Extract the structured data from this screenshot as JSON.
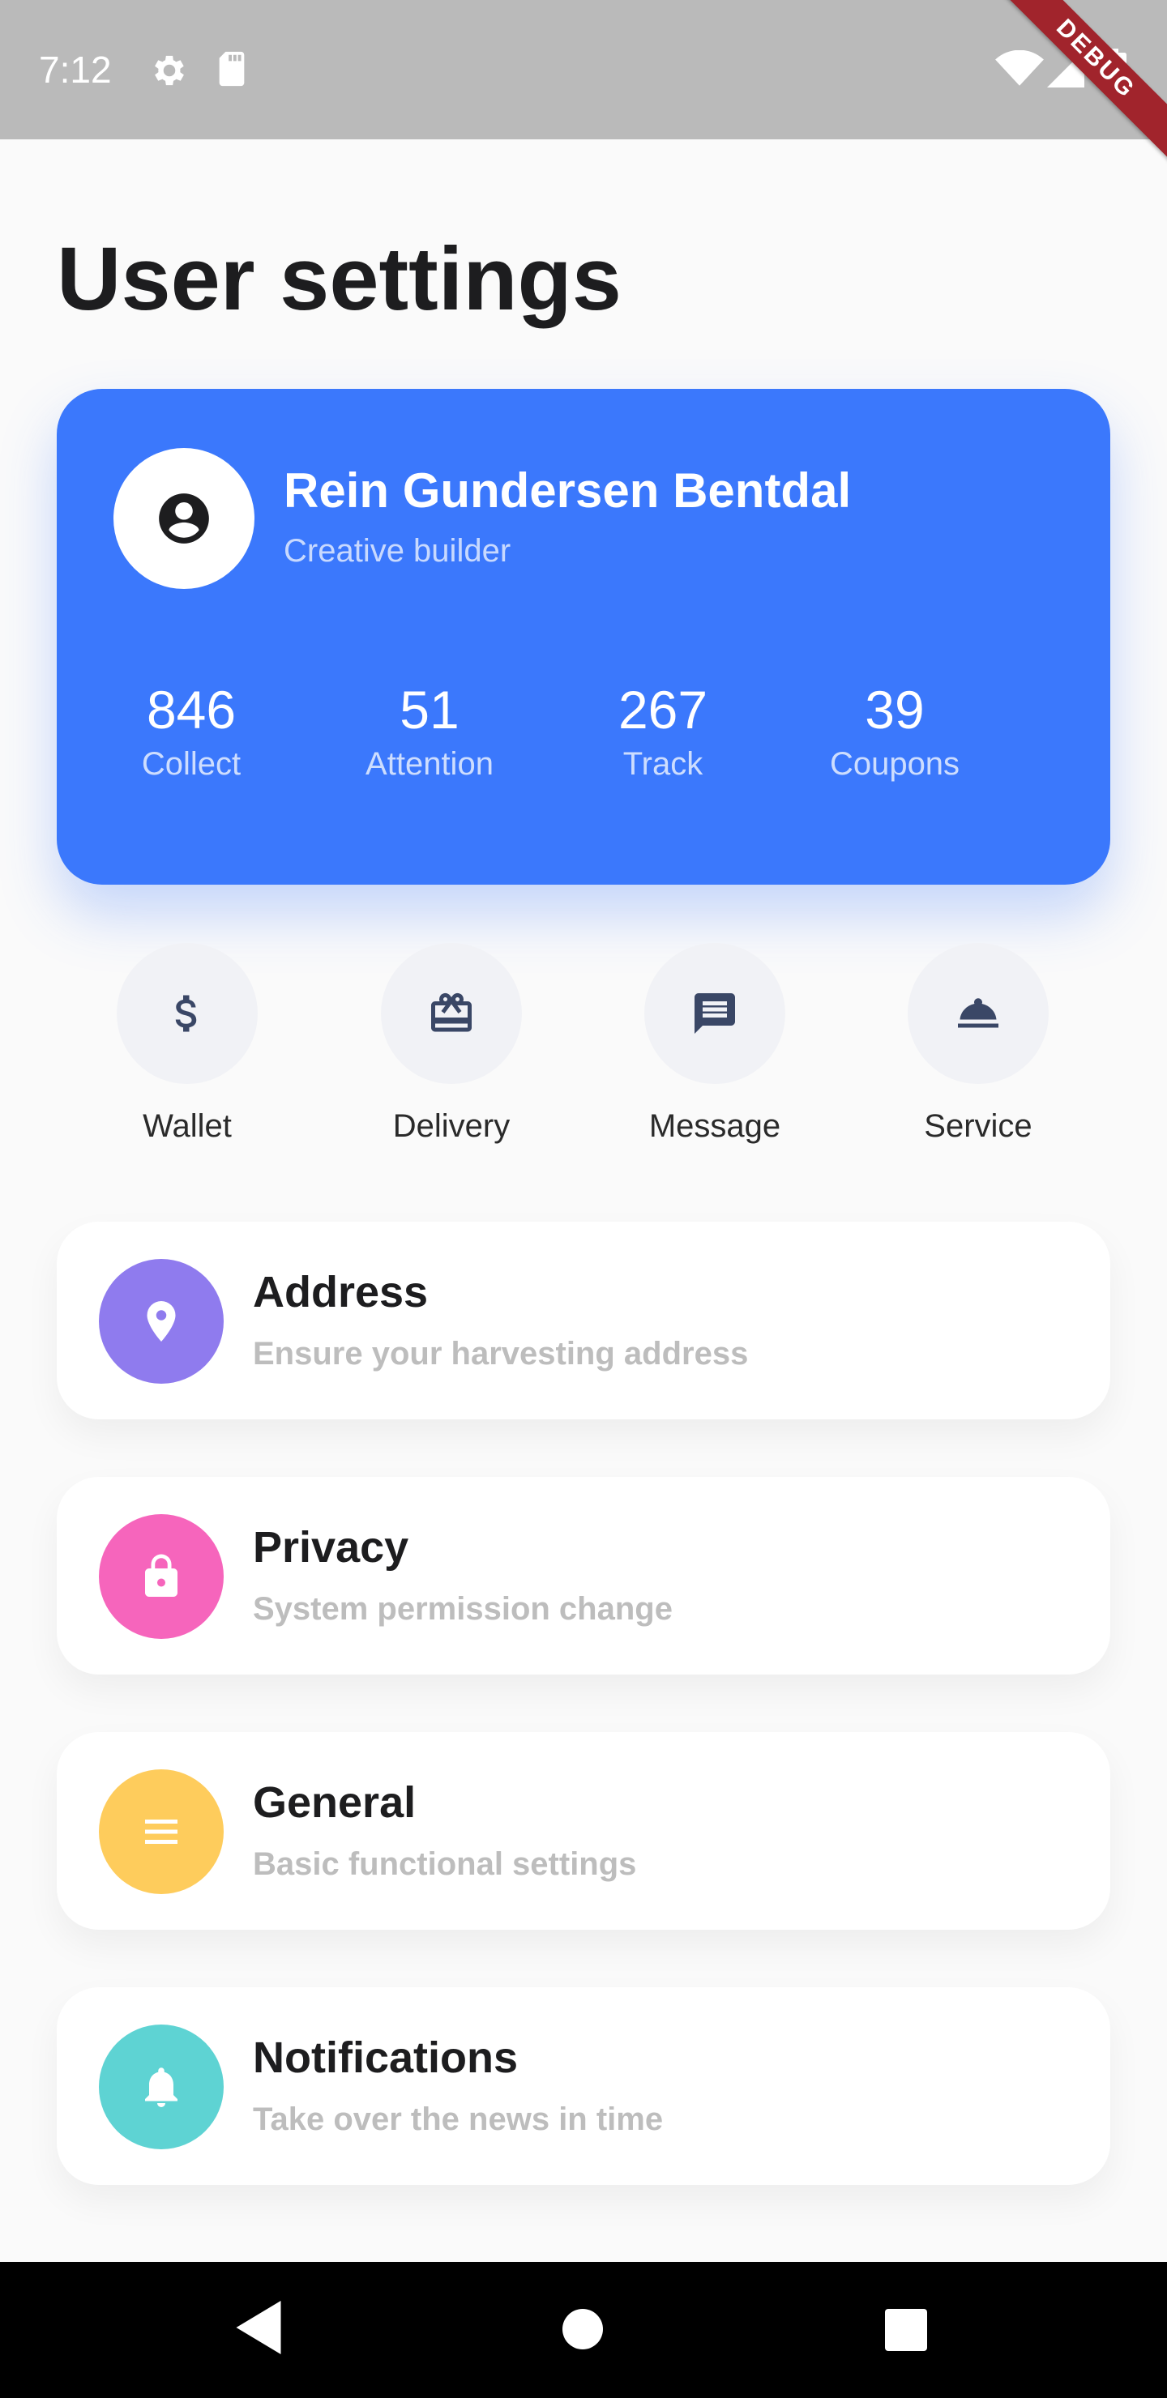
{
  "status_bar": {
    "time": "7:12",
    "icons": [
      "gear-icon",
      "sd-card-icon",
      "wifi-icon",
      "signal-icon",
      "battery-icon"
    ],
    "debug_banner": "DEBUG"
  },
  "page": {
    "title": "User settings"
  },
  "profile": {
    "name": "Rein Gundersen Bentdal",
    "role": "Creative builder",
    "avatar_icon": "account-circle-icon",
    "card_color": "#3b78fc",
    "stats": [
      {
        "value": "846",
        "label": "Collect"
      },
      {
        "value": "51",
        "label": "Attention"
      },
      {
        "value": "267",
        "label": "Track"
      },
      {
        "value": "39",
        "label": "Coupons"
      }
    ]
  },
  "quick_actions": [
    {
      "label": "Wallet",
      "icon": "dollar-icon"
    },
    {
      "label": "Delivery",
      "icon": "gift-card-icon"
    },
    {
      "label": "Message",
      "icon": "message-icon"
    },
    {
      "label": "Service",
      "icon": "room-service-icon"
    }
  ],
  "menu": [
    {
      "title": "Address",
      "subtitle": "Ensure your harvesting address",
      "icon": "location-pin-icon",
      "color": "#8f7bee"
    },
    {
      "title": "Privacy",
      "subtitle": "System permission change",
      "icon": "lock-icon",
      "color": "#f665bc"
    },
    {
      "title": "General",
      "subtitle": "Basic functional settings",
      "icon": "menu-lines-icon",
      "color": "#fecc5c"
    },
    {
      "title": "Notifications",
      "subtitle": "Take over the news in time",
      "icon": "bell-icon",
      "color": "#5ed3d3"
    }
  ],
  "nav_bar": {
    "icons": [
      "back-icon",
      "home-icon",
      "recents-icon"
    ]
  }
}
